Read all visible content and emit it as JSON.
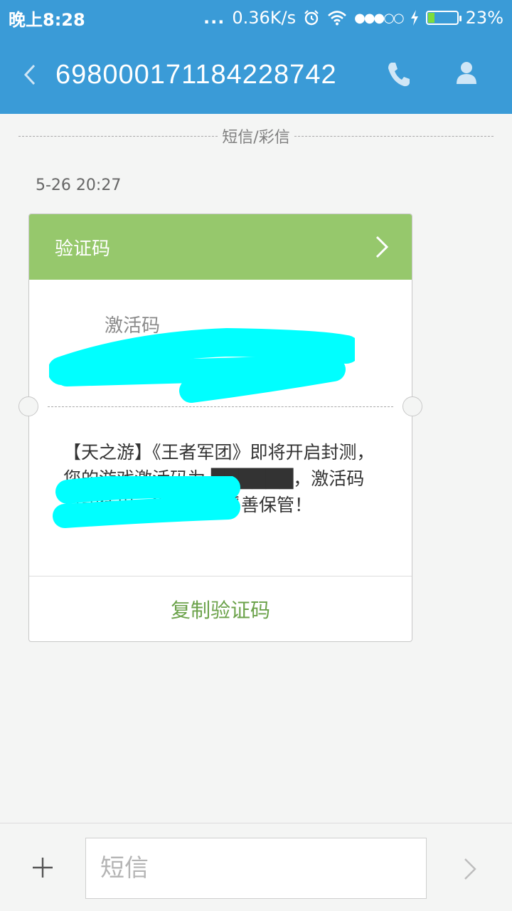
{
  "status_bar": {
    "time": "晚上8:28",
    "more": "...",
    "network_speed": "0.36K/s",
    "signal": "●●●○○",
    "battery_percent": "23%",
    "battery_level": 0.23,
    "icons": [
      "alarm-icon",
      "wifi-icon",
      "signal-icon",
      "charging-icon",
      "battery-icon"
    ]
  },
  "header": {
    "title": "6980001711842287​42",
    "icons": [
      "back-icon",
      "phone-icon",
      "contact-icon"
    ]
  },
  "thread": {
    "divider_label": "短信/彩信",
    "timestamp": "5-26 20:27"
  },
  "card": {
    "title": "验证码",
    "code_label": "激活码",
    "message": "【天之游】《王者军团》即将开启封测，您的游戏激活码为 ██████，激活码只能使用一次，请您妥善保管！",
    "copy_label": "复制验证码",
    "colors": {
      "header": "#96c86c",
      "copy_text": "#6ba24a",
      "redaction": "#00ffff"
    }
  },
  "composer": {
    "placeholder": "短信",
    "value": ""
  },
  "colors": {
    "app_bar": "#3a9bd7",
    "background": "#f4f5f4"
  }
}
